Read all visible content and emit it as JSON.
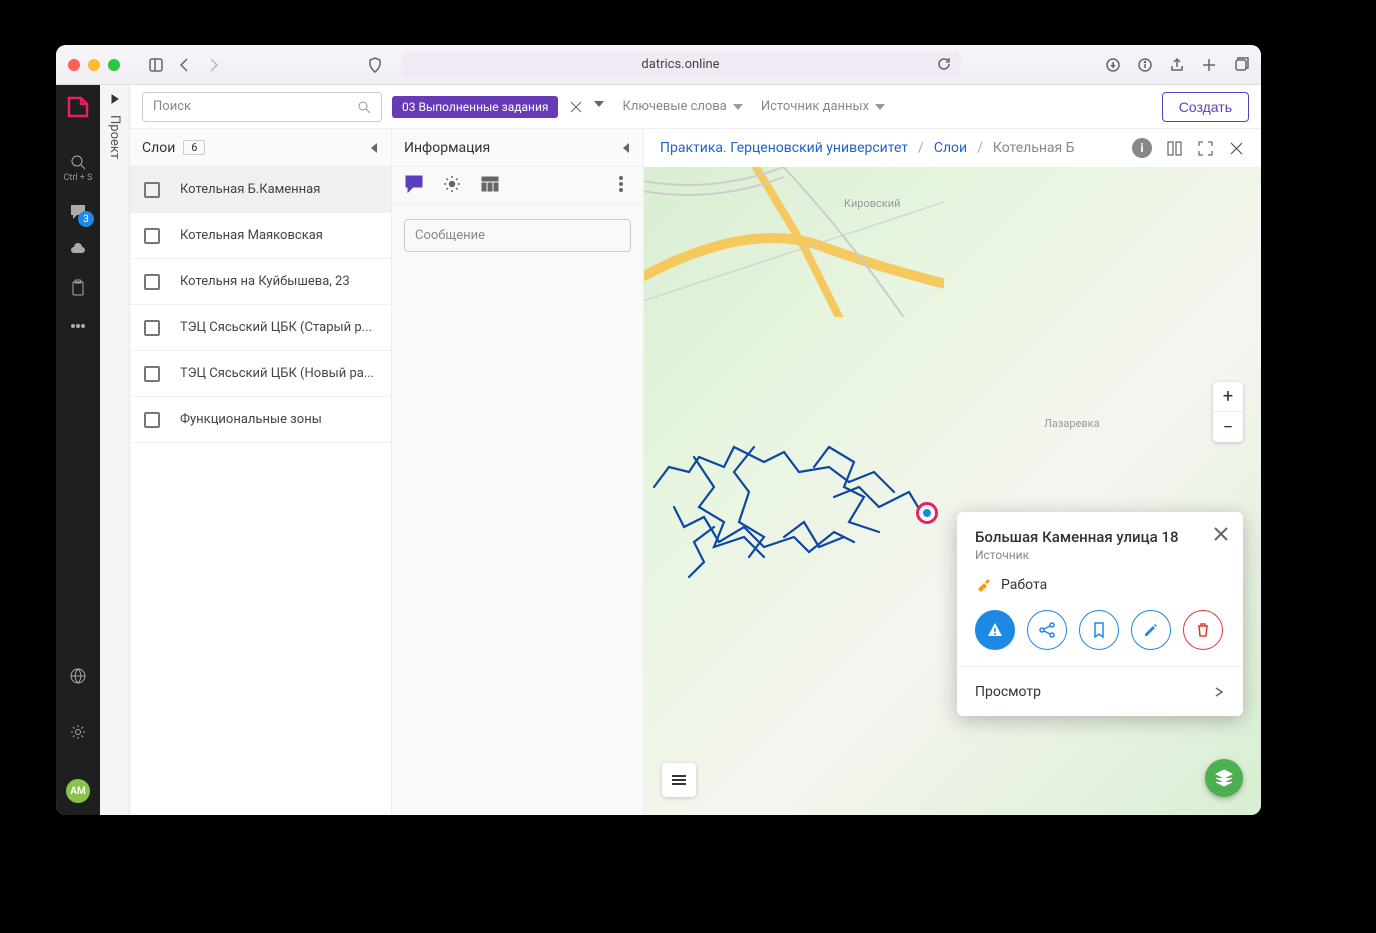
{
  "browser": {
    "url": "datrics.online"
  },
  "rail": {
    "search_shortcut": "Ctrl + S",
    "chat_badge": "3",
    "avatar": "АМ"
  },
  "vertical_tab": "Проект",
  "toolbar": {
    "search_placeholder": "Поиск",
    "chip": "03 Выполненные задания",
    "keywords_label": "Ключевые слова",
    "source_label": "Источник данных",
    "create_label": "Создать"
  },
  "layers": {
    "title": "Слои",
    "count": "6",
    "items": [
      {
        "label": "Котельная Б.Каменная",
        "active": true
      },
      {
        "label": "Котельная Маяковская",
        "active": false
      },
      {
        "label": "Котельня на Куйбышева, 23",
        "active": false
      },
      {
        "label": "ТЭЦ Сясьский ЦБК (Старый р...",
        "active": false
      },
      {
        "label": "ТЭЦ Сясьский ЦБК (Новый ра...",
        "active": false
      },
      {
        "label": "Функциональные зоны",
        "active": false
      }
    ]
  },
  "info": {
    "title": "Информация",
    "msg_placeholder": "Сообщение"
  },
  "breadcrumb": {
    "project": "Практика. Герценовский университет",
    "layers": "Слои",
    "current": "Котельная Б"
  },
  "map_labels": {
    "kirovsky": "Кировский",
    "lazarevka": "Лазаревка"
  },
  "popup": {
    "title": "Большая Каменная улица 18",
    "sub": "Источник",
    "tag": "Работа",
    "view": "Просмотр"
  }
}
